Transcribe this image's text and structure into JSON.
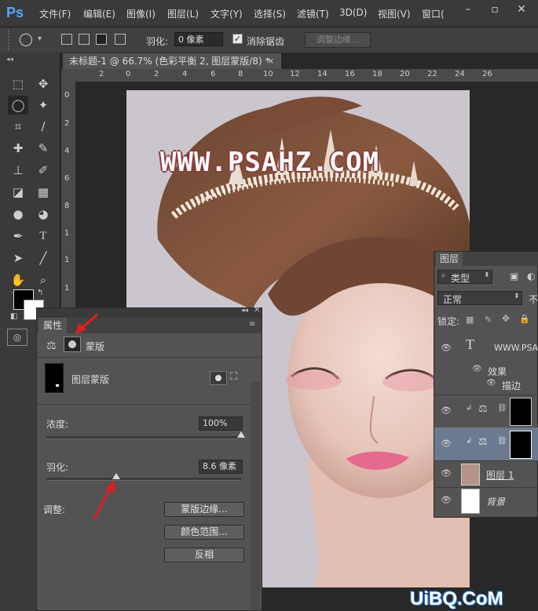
{
  "menubar": {
    "logo": "Ps",
    "items": [
      "文件(F)",
      "编辑(E)",
      "图像(I)",
      "图层(L)",
      "文字(Y)",
      "选择(S)",
      "滤镜(T)",
      "3D(D)",
      "视图(V)",
      "窗口("
    ]
  },
  "options": {
    "feather_label": "羽化:",
    "feather_value": "0 像素",
    "antialias_label": "消除锯齿",
    "refine_edge": "调整边缘..."
  },
  "document": {
    "tab_title": "未标题-1 @ 66.7% (色彩平衡 2, 图层蒙版/8) *",
    "close": "×",
    "ruler_h": [
      "2",
      "0",
      "2",
      "4",
      "6",
      "8",
      "10",
      "12",
      "14",
      "16",
      "18",
      "20",
      "22",
      "24",
      "26"
    ],
    "ruler_v": [
      "0",
      "2",
      "4",
      "6",
      "8",
      "1",
      "1",
      "1"
    ],
    "watermark": "WWW.PSAHZ.COM"
  },
  "properties": {
    "tab": "属性",
    "mode_label": "蒙版",
    "mask_label": "图层蒙版",
    "density_label": "浓度:",
    "density_value": "100%",
    "density_level": 1.0,
    "feather_label": "羽化:",
    "feather_value": "8.6 像素",
    "feather_level": 0.36,
    "adjust_label": "调整:",
    "btn_mask_edge": "蒙版边缘...",
    "btn_color_range": "颜色范围...",
    "btn_invert": "反相"
  },
  "layers": {
    "tab": "图层",
    "filter": "类型",
    "blend": "正常",
    "blend_extra": "不",
    "lock_label": "锁定:",
    "rows": [
      {
        "name": "WWW.PSAH"
      },
      {
        "name": "效果"
      },
      {
        "name": "描边"
      },
      {
        "name": "图层 1"
      },
      {
        "name": "背景"
      }
    ]
  },
  "site_watermark": "UiBQ.CoM",
  "colors": {
    "accent_red": "#e01e1e",
    "watermark_outline": "#8b3b3b"
  }
}
